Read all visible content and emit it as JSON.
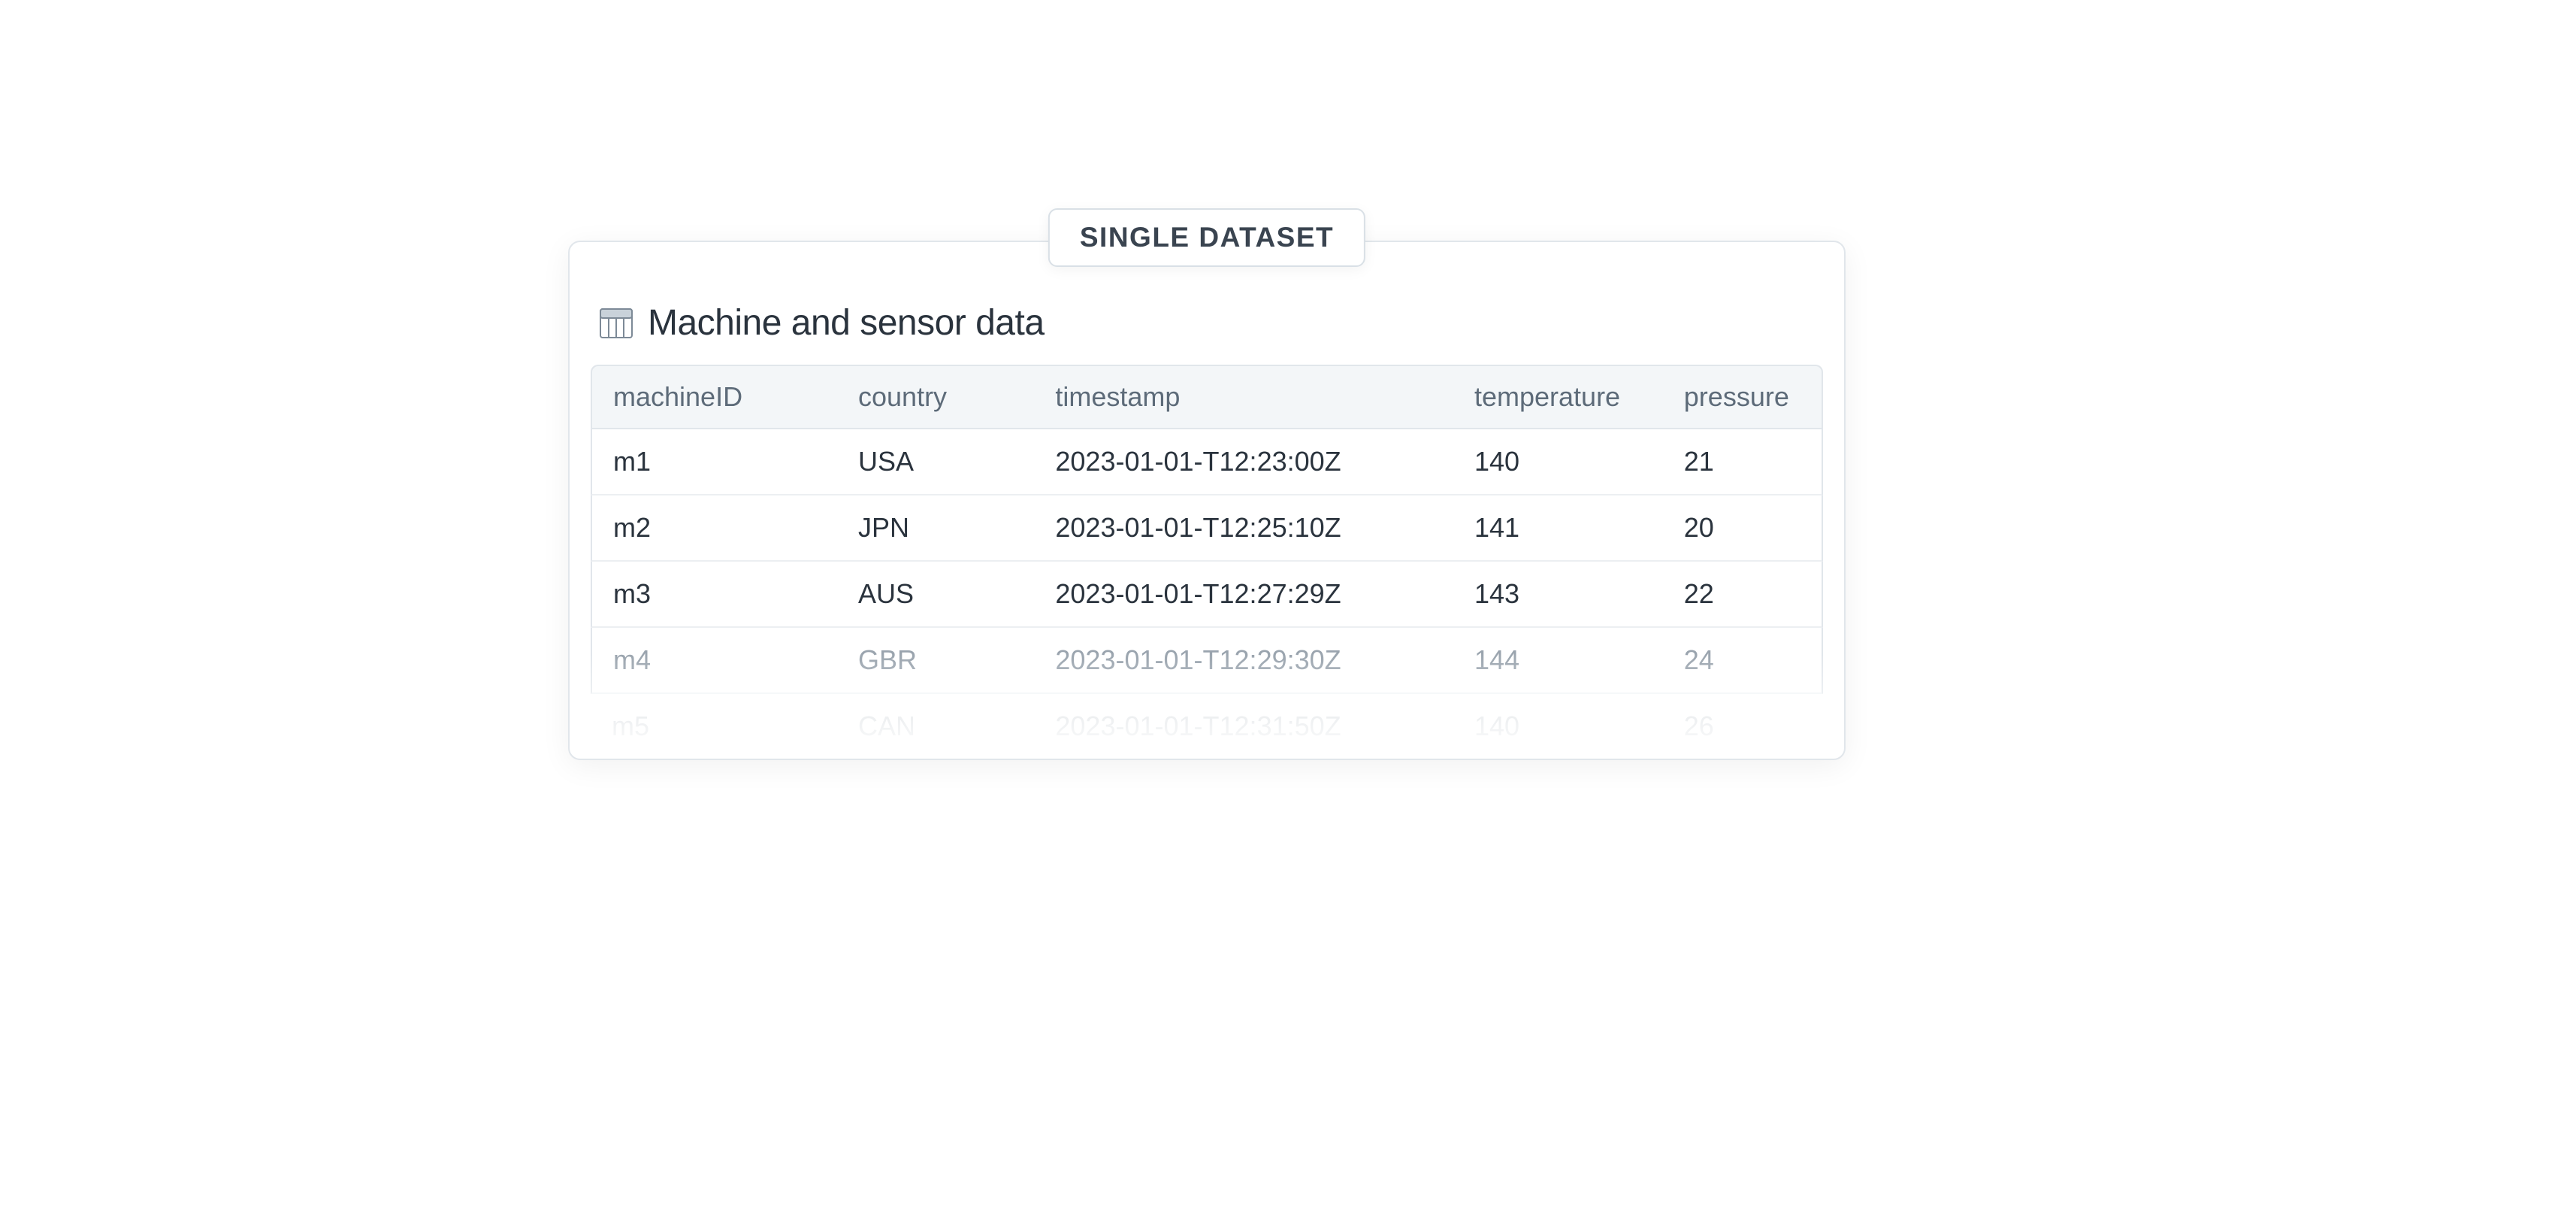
{
  "tab_label": "SINGLE DATASET",
  "card": {
    "title": "Machine and sensor data"
  },
  "table": {
    "headers": {
      "machineID": "machineID",
      "country": "country",
      "timestamp": "timestamp",
      "temperature": "temperature",
      "pressure": "pressure"
    },
    "rows": [
      {
        "machineID": "m1",
        "country": "USA",
        "timestamp": "2023-01-01-T12:23:00Z",
        "temperature": "140",
        "pressure": "21"
      },
      {
        "machineID": "m2",
        "country": "JPN",
        "timestamp": "2023-01-01-T12:25:10Z",
        "temperature": "141",
        "pressure": "20"
      },
      {
        "machineID": "m3",
        "country": "AUS",
        "timestamp": "2023-01-01-T12:27:29Z",
        "temperature": "143",
        "pressure": "22"
      },
      {
        "machineID": "m4",
        "country": "GBR",
        "timestamp": "2023-01-01-T12:29:30Z",
        "temperature": "144",
        "pressure": "24"
      },
      {
        "machineID": "m5",
        "country": "CAN",
        "timestamp": "2023-01-01-T12:31:50Z",
        "temperature": "140",
        "pressure": "26"
      }
    ]
  }
}
